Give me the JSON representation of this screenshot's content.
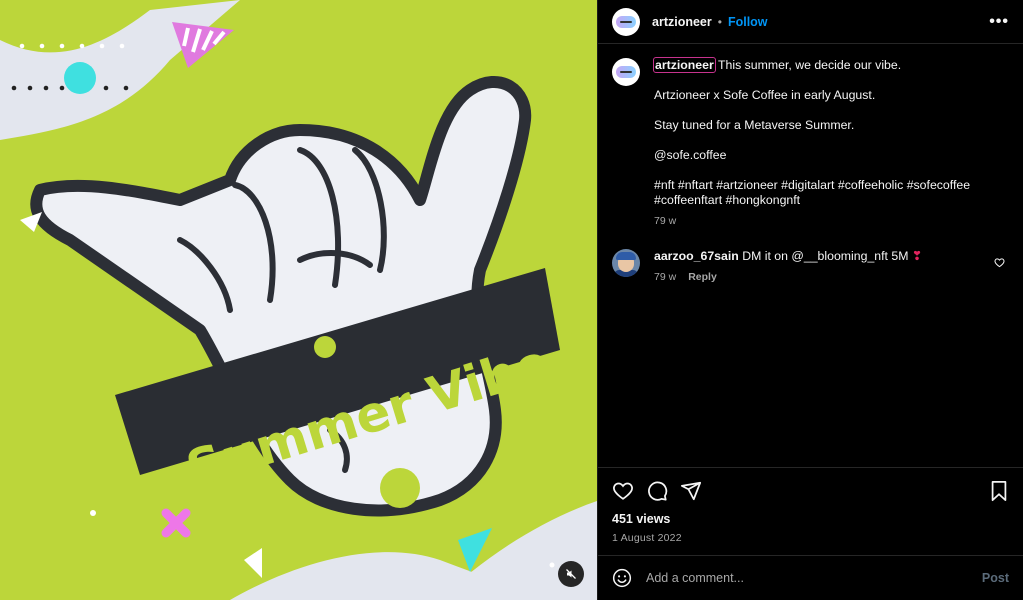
{
  "post": {
    "author": "artzioneer",
    "follow_label": "Follow",
    "separator": "•",
    "more_label": "•••",
    "artwork_text": "Summer Vibe !"
  },
  "caption": {
    "username": "artzioneer",
    "line1": "This summer, we decide our vibe.",
    "line2": "Artzioneer x Sofe Coffee in early August.",
    "line3": "Stay tuned for a Metaverse Summer.",
    "line4": "@sofe.coffee",
    "line5": "#nft #nftart #artzioneer #digitalart #coffeeholic #sofecoffee",
    "line6": "#coffeenftart #hongkongnft",
    "time": "79 w"
  },
  "comments": [
    {
      "username": "aarzoo_67sain",
      "text": "DM it on @__blooming_nft 5M",
      "emoji": "❣",
      "time": "79 w",
      "reply_label": "Reply"
    }
  ],
  "stats": {
    "views": "451 views",
    "date": "1 August 2022"
  },
  "composer": {
    "placeholder": "Add a comment...",
    "post_label": "Post"
  },
  "icons": [
    "heart-icon",
    "comment-icon",
    "share-icon",
    "bookmark-icon",
    "emoji-icon",
    "mute-icon"
  ],
  "colors": {
    "background": "#000000",
    "artwork_green": "#bcd63a",
    "follow_blue": "#0095f6",
    "secondary_text": "#a8a8a8"
  }
}
